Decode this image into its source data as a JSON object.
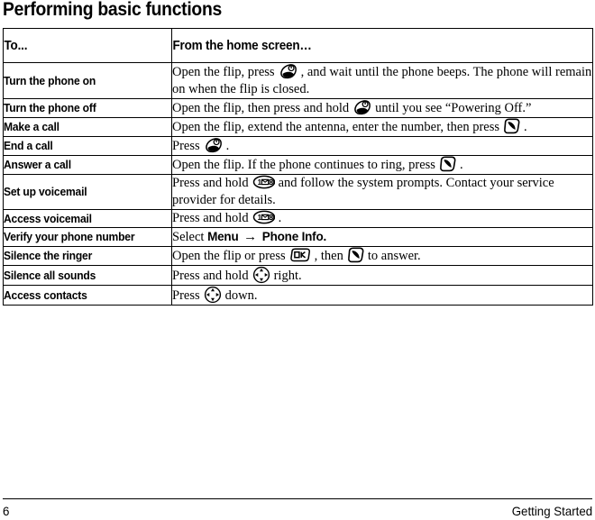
{
  "page": {
    "title": "Performing basic functions"
  },
  "table": {
    "headers": {
      "col1": "To...",
      "col2": "From the home screen…"
    },
    "rows": [
      {
        "label": "Turn the phone on",
        "parts": [
          {
            "type": "text",
            "value": "Open the flip, press"
          },
          {
            "type": "icon",
            "value": "power-key-icon"
          },
          {
            "type": "text",
            "value": ", and wait until the phone beeps. The phone will remain on when the flip is closed."
          }
        ]
      },
      {
        "label": "Turn the phone off",
        "parts": [
          {
            "type": "text",
            "value": "Open the flip, then press and hold"
          },
          {
            "type": "icon",
            "value": "power-key-icon"
          },
          {
            "type": "text",
            "value": "until you see “Powering Off.”"
          }
        ]
      },
      {
        "label": "Make a call",
        "parts": [
          {
            "type": "text",
            "value": "Open the flip, extend the antenna, enter the number, then press"
          },
          {
            "type": "icon",
            "value": "send-key-icon"
          },
          {
            "type": "text",
            "value": "."
          }
        ]
      },
      {
        "label": "End a call",
        "parts": [
          {
            "type": "text",
            "value": "Press"
          },
          {
            "type": "icon",
            "value": "power-key-icon"
          },
          {
            "type": "text",
            "value": "."
          }
        ]
      },
      {
        "label": "Answer a call",
        "parts": [
          {
            "type": "text",
            "value": "Open the flip. If the phone continues to ring, press"
          },
          {
            "type": "icon",
            "value": "send-key-icon"
          },
          {
            "type": "text",
            "value": "."
          }
        ]
      },
      {
        "label": "Set up voicemail",
        "parts": [
          {
            "type": "text",
            "value": "Press and hold"
          },
          {
            "type": "icon",
            "value": "voicemail-key-icon"
          },
          {
            "type": "text",
            "value": "and follow the system prompts. Contact your service provider for details."
          }
        ]
      },
      {
        "label": "Access voicemail",
        "parts": [
          {
            "type": "text",
            "value": "Press and hold"
          },
          {
            "type": "icon",
            "value": "voicemail-key-icon"
          },
          {
            "type": "text",
            "value": "."
          }
        ]
      },
      {
        "label": "Verify your phone number",
        "parts": [
          {
            "type": "text",
            "value": "Select"
          },
          {
            "type": "bold",
            "value": "Menu"
          },
          {
            "type": "arrow",
            "value": "→"
          },
          {
            "type": "bold",
            "value": "Phone Info."
          }
        ]
      },
      {
        "label": "Silence the ringer",
        "parts": [
          {
            "type": "text",
            "value": "Open the flip or press"
          },
          {
            "type": "icon",
            "value": "ok-key-icon"
          },
          {
            "type": "text",
            "value": ", then"
          },
          {
            "type": "icon",
            "value": "send-key-icon"
          },
          {
            "type": "text",
            "value": "to answer."
          }
        ]
      },
      {
        "label": "Silence all sounds",
        "parts": [
          {
            "type": "text",
            "value": "Press and hold"
          },
          {
            "type": "icon",
            "value": "navigation-key-icon"
          },
          {
            "type": "text",
            "value": "right."
          }
        ]
      },
      {
        "label": "Access contacts",
        "parts": [
          {
            "type": "text",
            "value": "Press"
          },
          {
            "type": "icon",
            "value": "navigation-key-icon"
          },
          {
            "type": "text",
            "value": "down."
          }
        ]
      }
    ]
  },
  "footer": {
    "page_number": "6",
    "section": "Getting Started"
  },
  "colors": {
    "text": "#000000",
    "background": "#ffffff",
    "rule": "#000000"
  }
}
